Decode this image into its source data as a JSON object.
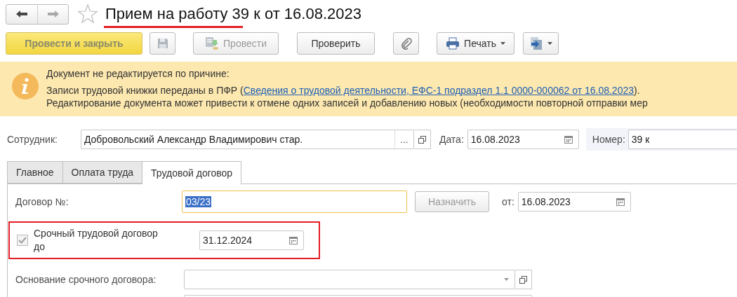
{
  "window": {
    "title": "Прием на работу 39 к от 16.08.2023",
    "favorite": false
  },
  "nav": {
    "back_disabled": false,
    "forward_disabled": true
  },
  "toolbar": {
    "post_close": {
      "label": "Провести и закрыть",
      "disabled": true
    },
    "save_disabled": true,
    "post": {
      "label": "Провести",
      "disabled": true
    },
    "check": {
      "label": "Проверить",
      "disabled": false
    },
    "print": {
      "label": "Печать"
    }
  },
  "banner": {
    "title": "Документ не редактируется по причине:",
    "reason_prefix": "Записи трудовой книжки переданы в ПФР (",
    "reason_link": "Сведения о трудовой деятельности, ЕФС-1 подраздел 1.1 0000-000062 от 16.08.2023",
    "reason_suffix": ").",
    "warning": "Редактирование документа может привести к отмене одних записей и добавлению новых (необходимости повторной отправки мер"
  },
  "header": {
    "employee": {
      "label": "Сотрудник:",
      "value": "Добровольский Александр Владимирович стар.",
      "choose": "..."
    },
    "date": {
      "label": "Дата:",
      "value": "16.08.2023"
    },
    "number": {
      "label": "Номер:",
      "value": "39 к"
    }
  },
  "tabs": [
    {
      "label": "Главное",
      "selected": false
    },
    {
      "label": "Оплата труда",
      "selected": false
    },
    {
      "label": "Трудовой договор",
      "selected": true
    }
  ],
  "contract": {
    "number": {
      "label": "Договор №:",
      "value": "03/23",
      "text_selected": true
    },
    "assign": {
      "label": "Назначить",
      "disabled": true
    },
    "from": {
      "label": "от:",
      "value": "16.08.2023"
    },
    "fixed_term": {
      "label": "Срочный трудовой договор до",
      "checked": true,
      "disabled": true,
      "date": "31.12.2024"
    },
    "basis": {
      "label": "Основание срочного договора:"
    }
  }
}
